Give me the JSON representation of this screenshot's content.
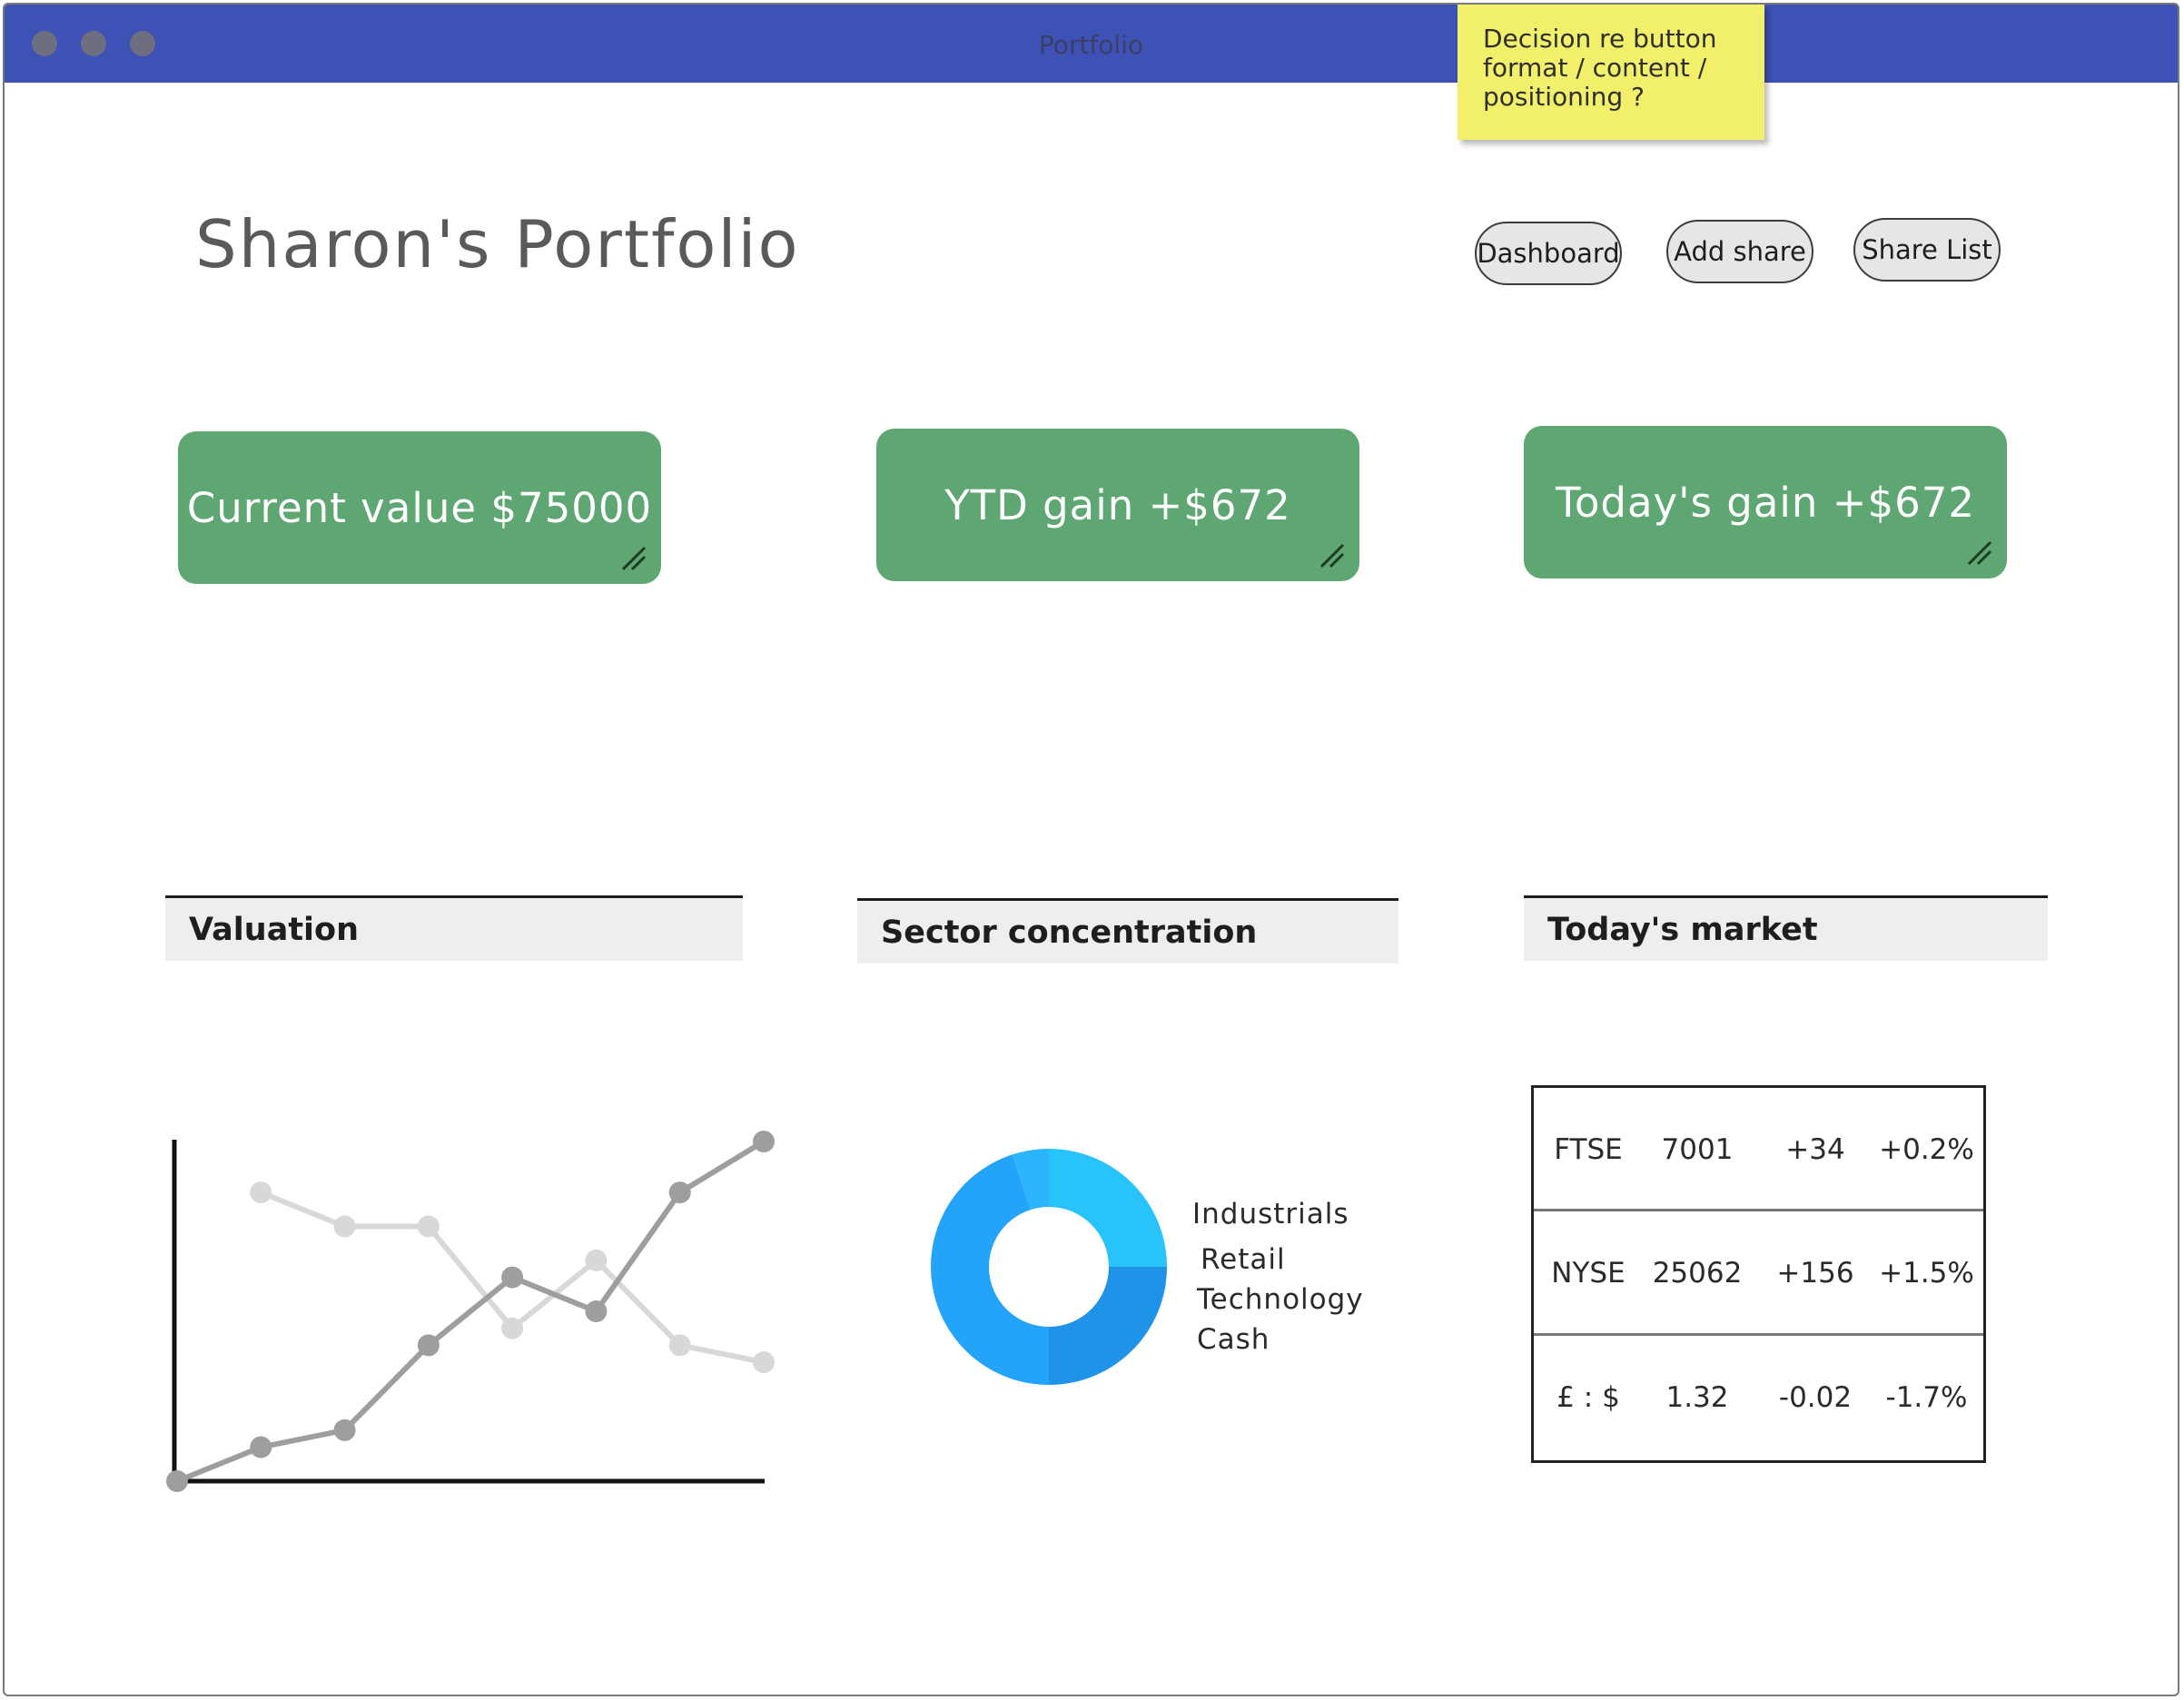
{
  "window": {
    "title": "Portfolio"
  },
  "sticky_note": {
    "text": "Decision re button format / content / positioning ?"
  },
  "page_title": "Sharon's Portfolio",
  "nav": [
    {
      "label": "Dashboard"
    },
    {
      "label": "Add share"
    },
    {
      "label": "Share List"
    }
  ],
  "kpis": [
    {
      "label": "Current value $75000"
    },
    {
      "label": "YTD gain +$672"
    },
    {
      "label": "Today's gain +$672"
    }
  ],
  "sections": {
    "valuation": "Valuation",
    "sector": "Sector concentration",
    "market": "Today's market"
  },
  "chart_data": [
    {
      "type": "line",
      "title": "",
      "xlabel": "",
      "ylabel": "",
      "x": [
        0,
        1,
        2,
        3,
        4,
        5,
        6,
        7
      ],
      "series": [
        {
          "values": [
            0,
            10,
            15,
            40,
            60,
            50,
            85,
            100
          ],
          "color": "#9e9e9e"
        },
        {
          "values": [
            null,
            85,
            75,
            75,
            45,
            65,
            40,
            35
          ],
          "color": "#d8d8d8"
        }
      ],
      "ylim": [
        0,
        100
      ],
      "grid": false,
      "legend": "none"
    },
    {
      "type": "pie",
      "donut": true,
      "categories": [
        "Industrials",
        "Retail",
        "Technology",
        "Cash"
      ],
      "values": [
        25,
        25,
        45,
        5
      ],
      "colors": [
        "#29c3fc",
        "#1f93e8",
        "#24a3fb",
        "#2cb4fd"
      ],
      "legend": "right"
    }
  ],
  "market": {
    "rows": [
      {
        "name": "FTSE",
        "value": "7001",
        "change": "+34",
        "pct": "+0.2%"
      },
      {
        "name": "NYSE",
        "value": "25062",
        "change": "+156",
        "pct": "+1.5%"
      },
      {
        "name": "£ : $",
        "value": "1.32",
        "change": "-0.02",
        "pct": "-1.7%"
      }
    ]
  }
}
